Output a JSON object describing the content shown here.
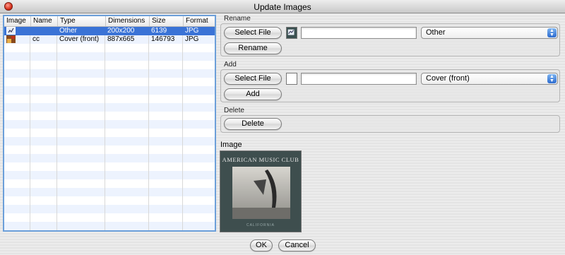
{
  "window": {
    "title": "Update Images"
  },
  "table": {
    "columns": [
      "Image",
      "Name",
      "Type",
      "Dimensions",
      "Size",
      "Format"
    ],
    "rows": [
      {
        "name": "",
        "type": "Other",
        "dimensions": "200x200",
        "size": "6139",
        "format": "JPG",
        "selected": true
      },
      {
        "name": "cc",
        "type": "Cover (front)",
        "dimensions": "887x665",
        "size": "146793",
        "format": "JPG",
        "selected": false
      }
    ]
  },
  "rename": {
    "label": "Rename",
    "select_file_label": "Select File",
    "file_value": "",
    "type_value": "Other",
    "rename_label": "Rename"
  },
  "add": {
    "label": "Add",
    "select_file_label": "Select File",
    "file_value": "",
    "type_value": "Cover (front)",
    "add_label": "Add"
  },
  "delete": {
    "label": "Delete",
    "delete_label": "Delete"
  },
  "preview": {
    "label": "Image",
    "cover_title": "AMERICAN MUSIC CLUB",
    "cover_subtitle": "CALIFORNIA"
  },
  "footer": {
    "ok_label": "OK",
    "cancel_label": "Cancel"
  }
}
